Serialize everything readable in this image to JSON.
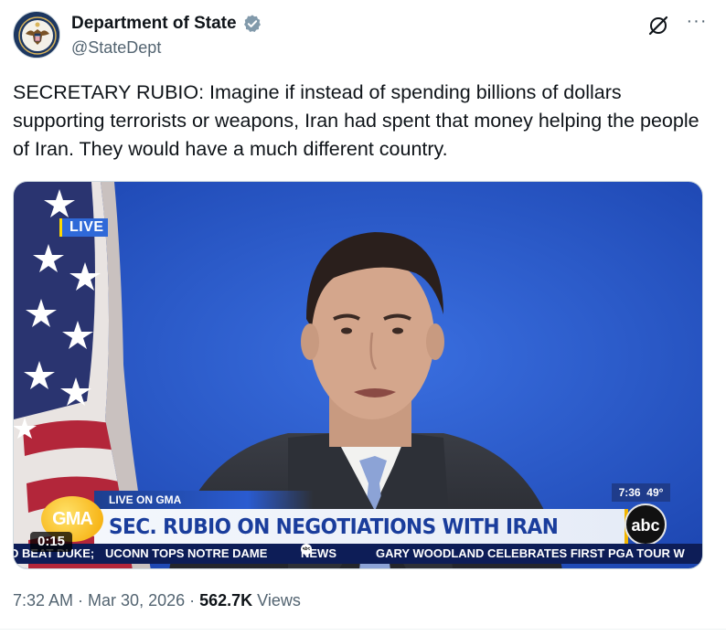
{
  "account": {
    "name": "Department of State",
    "handle": "@StateDept",
    "verified": true,
    "avatar": "department-of-state-seal"
  },
  "tweet": {
    "text": "SECRETARY RUBIO: Imagine if instead of spending billions of dollars supporting terrorists or weapons, Iran had spent that money helping the people of Iran. They would have a much different country."
  },
  "actions": {
    "grok_icon": "grok-slash-icon",
    "more_label": "···"
  },
  "video": {
    "live_badge": "LIVE",
    "live_on": "LIVE ON GMA",
    "gma_logo": "GMA",
    "headline": "SEC. RUBIO ON NEGOTIATIONS WITH IRAN",
    "clock": "7:36",
    "temperature": "49°",
    "network_logo": "abc",
    "ticker": {
      "item1": "D BEAT DUKE;",
      "item2": "UCONN TOPS NOTRE DAME",
      "news_label": "NEWS",
      "item3": "GARY WOODLAND CELEBRATES FIRST PGA TOUR W"
    },
    "duration": "0:15"
  },
  "meta": {
    "time": "7:32 AM",
    "separator": " · ",
    "date": "Mar 30, 2026",
    "views_count": "562.7K",
    "views_label": " Views"
  },
  "colors": {
    "verified": "#829aab",
    "text": "#0f1419",
    "muted": "#536471",
    "backdrop": "#2f5fd0",
    "headline": "#1a3d9c",
    "ticker_bg": "#0d1d57"
  }
}
